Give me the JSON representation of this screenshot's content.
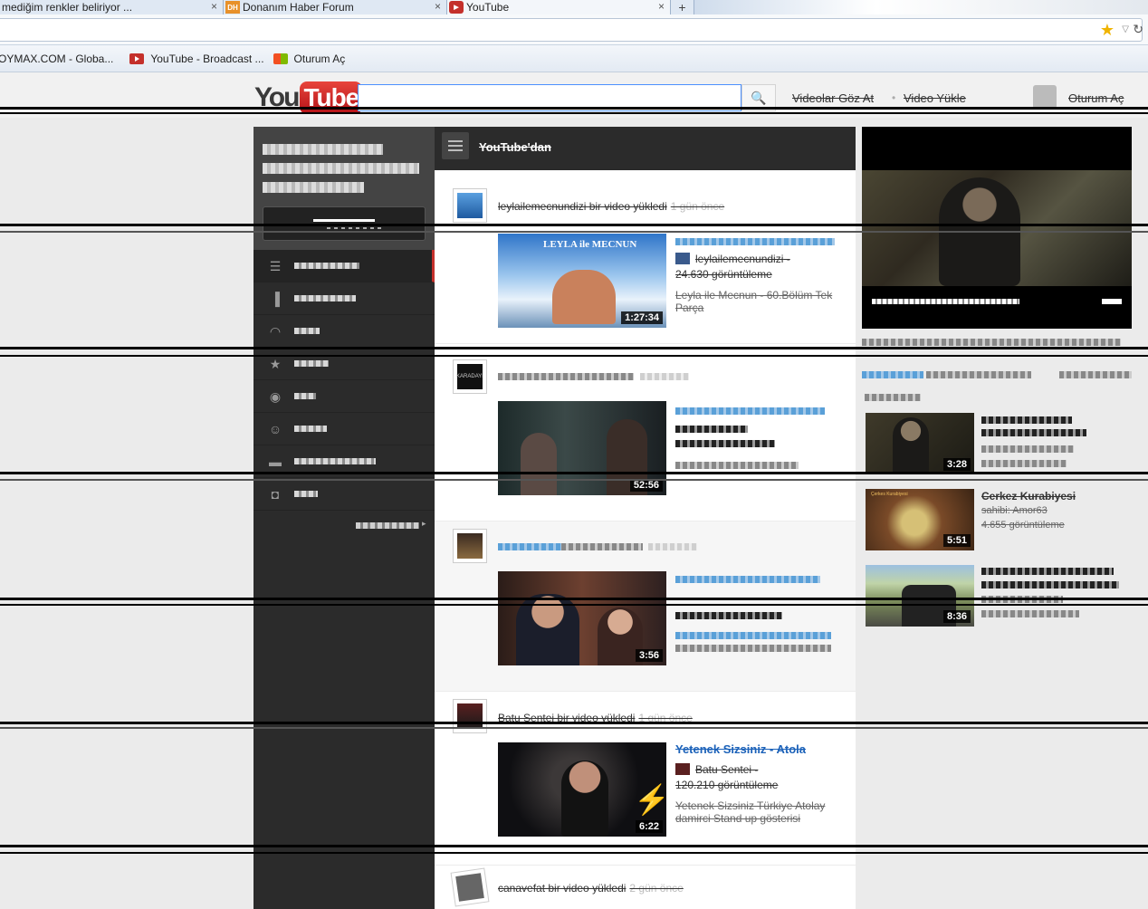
{
  "browser": {
    "tabs": [
      {
        "label": "mediğim renkler beliriyor ...",
        "close": "×",
        "favicon": "page-icon"
      },
      {
        "label": "Donanım Haber Forum",
        "close": "×",
        "favicon": "dh-icon",
        "fav_text": "DH"
      },
      {
        "label": "YouTube",
        "close": "×",
        "favicon": "youtube-icon",
        "active": true
      }
    ],
    "new_tab": "+",
    "star": "★",
    "dropdown": "▽",
    "reload": "↻",
    "bookmarks": [
      {
        "label": "OYMAX.COM - Globa..."
      },
      {
        "label": "YouTube - Broadcast ...",
        "icon": "youtube-icon"
      },
      {
        "label": "Oturum Aç",
        "icon": "windows-icon"
      }
    ]
  },
  "youtube_header": {
    "logo_you": "You",
    "logo_tube": "Tube",
    "search_icon": "🔍",
    "links": [
      "Videolar Göz At",
      "Video Yükle"
    ],
    "separator": "•",
    "sign_in": "Oturum Aç"
  },
  "feed": {
    "title": "YouTube'dan",
    "items": [
      {
        "actor": "leylailemecnundizi bir video yükledi",
        "time": "1 gün önce",
        "duration": "1:27:34",
        "channel": "leylailemecnundizi",
        "views": "24.630 görüntüleme",
        "desc": "Leyla ile Mecnun - 60.Bölüm Tek Parça",
        "thumb_text": "LEYLA ile MECNUN"
      },
      {
        "duration": "52:56",
        "avatar_text": "KARADAYI"
      },
      {
        "duration": "3:56"
      },
      {
        "actor": "Batu Sentei bir video yükledi",
        "time": "1 gün önce",
        "duration": "6:22",
        "title": "Yetenek Sizsiniz - Atola",
        "channel": "Batu Sentei",
        "views": "120.210 görüntüleme",
        "desc": "Yetenek Sizsiniz Türkiye Atolay damirci Stand up gösterisi"
      },
      {
        "actor": "canavefat bir video yükledi",
        "time": "2 gün önce"
      }
    ]
  },
  "right_column": {
    "recommendations": [
      {
        "duration": "3:28"
      },
      {
        "duration": "5:51",
        "title": "Cerkez Kurabiyesi",
        "channel": "sahibi: Amor63",
        "views": "4.655 görüntüleme",
        "thumb_text": "Çerkes Kurabiyesi"
      },
      {
        "duration": "8:36"
      }
    ]
  },
  "colors": {
    "accent": "#c4302b",
    "link": "#1c62b9",
    "sidebar": "#2b2b2b"
  }
}
